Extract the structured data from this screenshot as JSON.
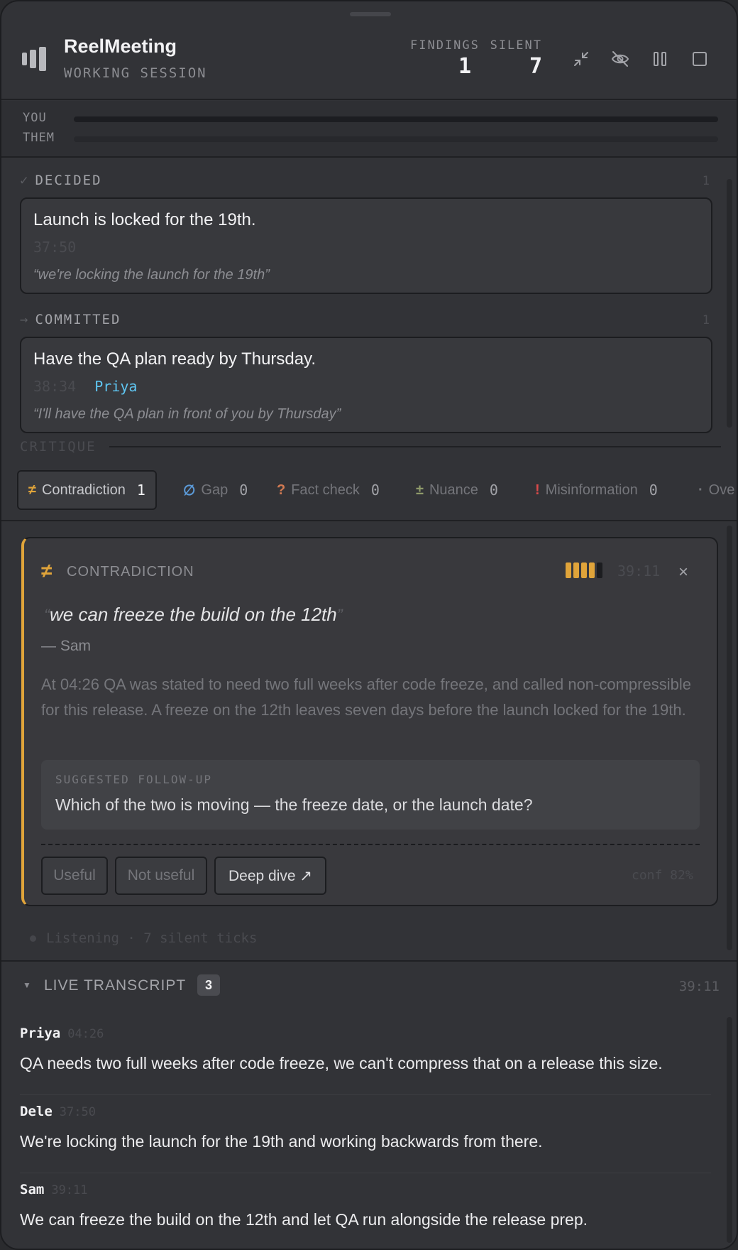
{
  "app": {
    "title": "ReelMeeting",
    "mode": "WORKING SESSION"
  },
  "stats": {
    "findings_label": "FINDINGS",
    "findings_value": "1",
    "silent_label": "SILENT",
    "silent_value": "7"
  },
  "header_icons": [
    "collapse-icon",
    "eye-off-icon",
    "pause-icon",
    "stop-icon"
  ],
  "meter": {
    "you_label": "YOU",
    "them_label": "THEM"
  },
  "decided": {
    "glyph": "✓",
    "label": "DECIDED",
    "count": "1",
    "items": [
      {
        "text": "Launch is locked for the 19th.",
        "time": "37:50",
        "quote": "“we're locking the launch for the 19th”"
      }
    ]
  },
  "committed": {
    "glyph": "→",
    "label": "COMMITTED",
    "count": "1",
    "items": [
      {
        "text": "Have the QA plan ready by Thursday.",
        "time": "38:34",
        "owner": "Priya",
        "quote": "“I'll have the QA plan in front of you by Thursday”"
      }
    ]
  },
  "critique": {
    "label": "CRITIQUE",
    "tabs": [
      {
        "glyph": "≠",
        "label": "Contradiction",
        "count": "1",
        "color": "#e0a43a"
      },
      {
        "glyph": "∅",
        "label": "Gap",
        "count": "0",
        "color": "#5b9ad8"
      },
      {
        "glyph": "?",
        "label": "Fact check",
        "count": "0",
        "color": "#d27a52"
      },
      {
        "glyph": "±",
        "label": "Nuance",
        "count": "0",
        "color": "#8f9a6a"
      },
      {
        "glyph": "!",
        "label": "Misinformation",
        "count": "0",
        "color": "#d94a4a"
      },
      {
        "glyph": "·",
        "label": "Ove",
        "count": "",
        "color": "#74757a"
      }
    ]
  },
  "finding": {
    "glyph": "≠",
    "kind": "CONTRADICTION",
    "confidence_level": 0.82,
    "time": "39:11",
    "close": "×",
    "quote": "we can freeze the build on the 12th",
    "open_quote": "“",
    "close_quote": "”",
    "speaker": "— Sam",
    "body": "At 04:26 QA was stated to need two full weeks after code freeze, and called non-compressible for this release. A freeze on the 12th leaves seven days before the launch locked for the 19th.",
    "followup_label": "SUGGESTED FOLLOW-UP",
    "followup": "Which of the two is moving — the freeze date, or the launch date?",
    "buttons": {
      "useful": "Useful",
      "not_useful": "Not useful",
      "deep_dive": "Deep dive ↗"
    },
    "conf_text": "conf 82%"
  },
  "listening": "Listening · 7 silent ticks",
  "transcript": {
    "chevron": "▼",
    "title": "LIVE TRANSCRIPT",
    "count": "3",
    "time": "39:11",
    "items": [
      {
        "speaker": "Priya",
        "time": "04:26",
        "text": "QA needs two full weeks after code freeze, we can't compress that on a release this size."
      },
      {
        "speaker": "Dele",
        "time": "37:50",
        "text": "We're locking the launch for the 19th and working backwards from there."
      },
      {
        "speaker": "Sam",
        "time": "39:11",
        "text": "We can freeze the build on the 12th and let QA run alongside the release prep."
      }
    ]
  },
  "colors": {
    "accent": "#e0a43a",
    "owner": "#5fc6f2"
  }
}
